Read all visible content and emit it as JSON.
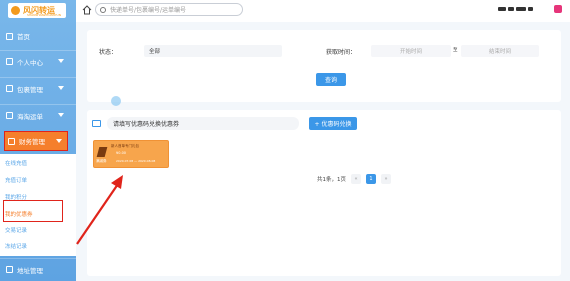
{
  "app": {
    "logo_text": "风闪转运",
    "logo_sub": "SHANSHANZHUANYUN"
  },
  "sidebar": {
    "items": [
      {
        "label": "首页"
      },
      {
        "label": "个人中心"
      },
      {
        "label": "包裹管理"
      },
      {
        "label": "海淘运单"
      },
      {
        "label": "财务管理"
      },
      {
        "label": "地址管理"
      }
    ],
    "finance_sub": [
      {
        "label": "在线充值"
      },
      {
        "label": "充值订单"
      },
      {
        "label": "我的积分"
      },
      {
        "label": "我的优惠券"
      },
      {
        "label": "交易记录"
      },
      {
        "label": "冻结记录"
      }
    ]
  },
  "topbar": {
    "search_placeholder": "快递单号/包裹编号/运单编号"
  },
  "filter": {
    "status_label": "状态：",
    "status_value": "全部",
    "time_label": "获取时间：",
    "start_placeholder": "开始时间",
    "range_sep": "至",
    "end_placeholder": "结束时间",
    "query_label": "查询"
  },
  "coupon_panel": {
    "input_placeholder": "请填写优惠码兑换优惠券",
    "redeem_label": "+ 优惠码兑换",
    "coupons": [
      {
        "title": "新人首单专门礼包",
        "type": "满减券",
        "amount": "¥0.00",
        "date": "2020.07.08 — 2020.08.08"
      }
    ],
    "pagination": {
      "summary": "共1条，1页",
      "prev": "«",
      "page": "1",
      "next": "»"
    }
  },
  "colors": {
    "sidebar": "#6aaee6",
    "accent": "#3b97e8",
    "finance_active": "#f57f2c",
    "highlight_border": "#e0241b",
    "coupon": "#f7a54c"
  }
}
